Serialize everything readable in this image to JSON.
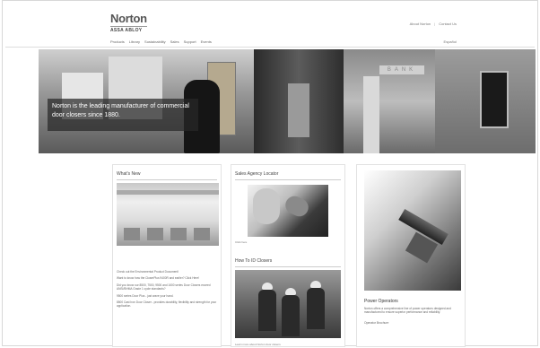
{
  "header": {
    "logo_main": "Norton",
    "logo_sub": "ASSA ABLOY",
    "nav": [
      "Products",
      "Library",
      "Sustainability",
      "Sales",
      "Support",
      "Events"
    ],
    "utility": [
      "About Norton",
      "Contact Us"
    ],
    "utility_sep": "|",
    "language": "Español"
  },
  "hero": {
    "caption": "Norton is the leading manufacturer of commercial door closers since 1880.",
    "bank_sign": "BANK"
  },
  "whats_new": {
    "title": "What's New",
    "items": [
      "Check out the Environmental Product Document!",
      "Want to know how the CloserPlus 9400R and earlier? Click Here!",
      "Did you know our 8500, 7500, 9500 and 1600 series Door Closers exceed ANSI/BHMA Grade 1 cycle standards?",
      "9500 series Door Plus - just wave your hand.",
      "8500 Cast Iron Door Closer - provides durability, flexibility and strength for your application."
    ]
  },
  "sales": {
    "title": "Sales Agency Locator",
    "caption": "Click here",
    "section2_title": "How To ID Closers",
    "caption2": "Learn more about Norton door closers"
  },
  "power": {
    "title": "Power Operators",
    "description": "Norton offers a comprehensive line of power operators designed and manufactured to ensure superior performance and reliability.",
    "link": "Operator Brochure"
  }
}
